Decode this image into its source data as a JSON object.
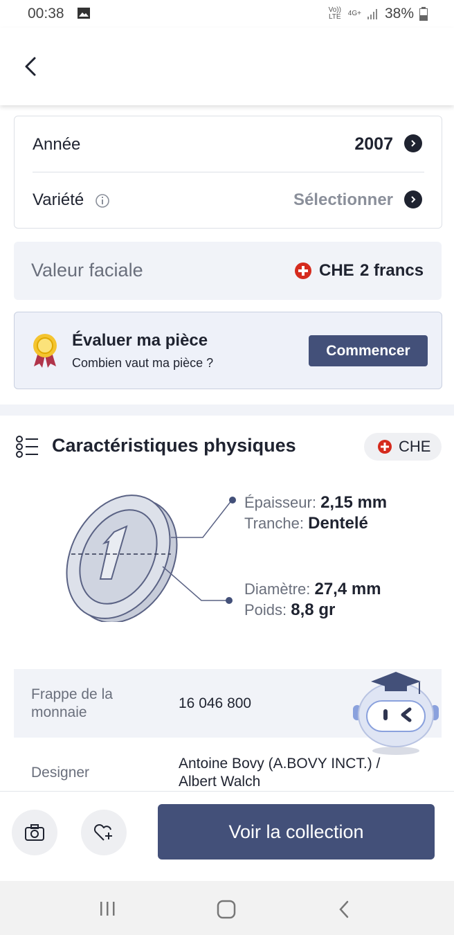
{
  "status_bar": {
    "time": "00:38",
    "volte": "Vo)) LTE",
    "network": "4G+",
    "battery": "38%"
  },
  "details": {
    "year_label": "Année",
    "year_value": "2007",
    "variety_label": "Variété",
    "variety_value": "Sélectionner"
  },
  "facial": {
    "label": "Valeur faciale",
    "country": "CHE",
    "value": "2 francs"
  },
  "evaluate": {
    "title": "Évaluer ma pièce",
    "subtitle": "Combien vaut ma pièce ?",
    "button": "Commencer"
  },
  "physical": {
    "title": "Caractéristiques physiques",
    "country": "CHE",
    "thickness_label": "Épaisseur:",
    "thickness_value": "2,15 mm",
    "edge_label": "Tranche:",
    "edge_value": "Dentelé",
    "diameter_label": "Diamètre:",
    "diameter_value": "27,4 mm",
    "weight_label": "Poids:",
    "weight_value": "8,8 gr"
  },
  "table": [
    {
      "label": "Frappe de la monnaie",
      "value": "16 046 800"
    },
    {
      "label": "Designer",
      "value": "Antoine Bovy (A.BOVY INCT.) / Albert Walch"
    }
  ],
  "bottom": {
    "collection_button": "Voir la collection"
  },
  "colors": {
    "primary": "#435079",
    "card_bg": "#f1f3f8",
    "swiss_red": "#d52b1e"
  }
}
